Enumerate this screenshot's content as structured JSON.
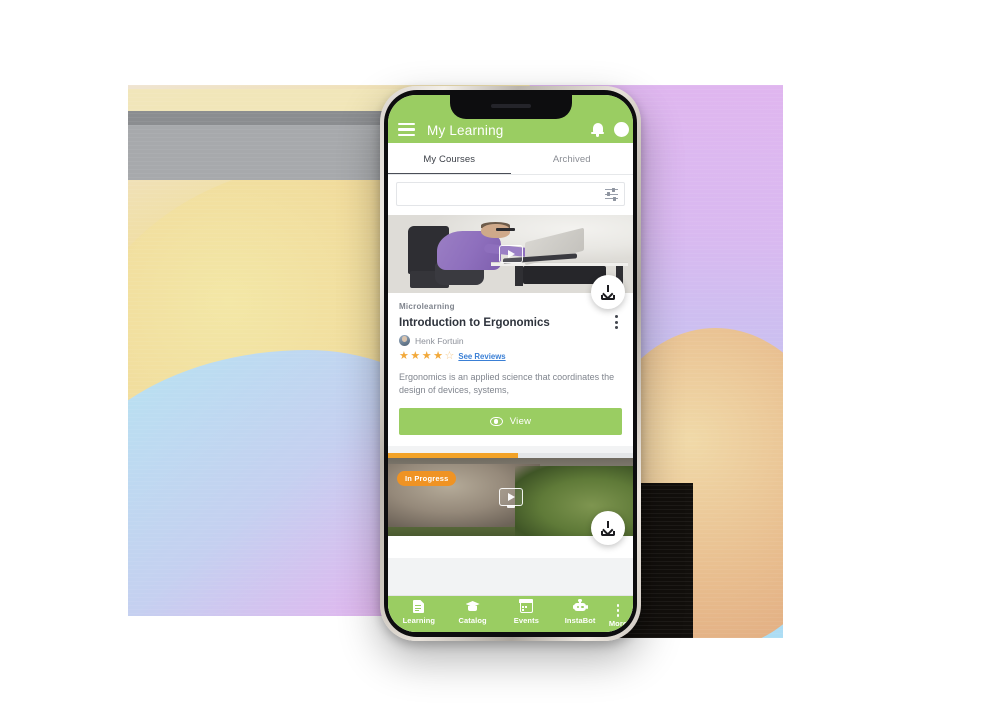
{
  "app": {
    "title": "My Learning",
    "menu_icon": "hamburger-icon",
    "notification_icon": "bell-icon",
    "accent_green": "#9ACD62",
    "accent_orange": "#EF9324",
    "link_blue": "#3A7FD5"
  },
  "tabs": [
    {
      "label": "My Courses",
      "active": true
    },
    {
      "label": "Archived",
      "active": false
    }
  ],
  "search": {
    "value": "",
    "placeholder": "",
    "filter_icon": "filter-sliders-icon"
  },
  "cards": [
    {
      "category": "Microlearning",
      "title": "Introduction to Ergonomics",
      "author": "Henk Fortuin",
      "rating": 4,
      "rating_max": 5,
      "reviews_link": "See Reviews",
      "description": "Ergonomics is an applied science that coordinates the design of devices, systems,",
      "action_label": "View",
      "action_icon": "eye-icon",
      "download_icon": "download-icon",
      "overflow_icon": "kebab-menu-icon",
      "media_icon": "play-button-icon"
    },
    {
      "badge": "In Progress",
      "progress_percent": 53,
      "download_icon": "download-icon",
      "media_icon": "play-button-icon"
    }
  ],
  "bottom_nav": [
    {
      "label": "Learning",
      "icon": "document-icon"
    },
    {
      "label": "Catalog",
      "icon": "graduation-cap-icon"
    },
    {
      "label": "Events",
      "icon": "calendar-icon"
    },
    {
      "label": "InstaBot",
      "icon": "robot-icon"
    },
    {
      "label": "More",
      "icon": "kebab-menu-icon"
    }
  ]
}
